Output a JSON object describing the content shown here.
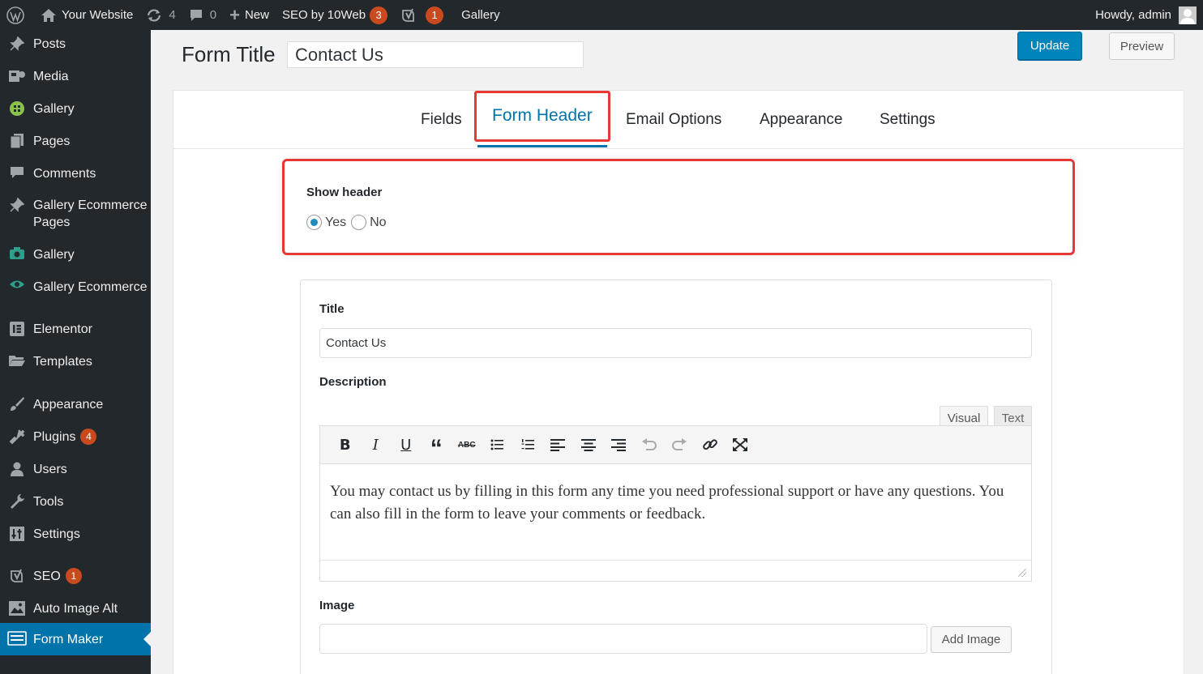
{
  "admin_bar": {
    "site_name": "Your Website",
    "updates_count": "4",
    "comments_count": "0",
    "new_label": "New",
    "seo_10web_label": "SEO by 10Web",
    "seo_10web_badge": "3",
    "yoast_badge": "1",
    "gallery_label": "Gallery",
    "howdy": "Howdy, admin"
  },
  "sidebar": {
    "items": [
      {
        "label": "Posts",
        "icon": "pushpin-icon"
      },
      {
        "label": "Media",
        "icon": "media-icon"
      },
      {
        "label": "Gallery",
        "icon": "gallery-icon"
      },
      {
        "label": "Pages",
        "icon": "pages-icon"
      },
      {
        "label": "Comments",
        "icon": "comments-icon"
      },
      {
        "label": "Gallery Ecommerce Pages",
        "icon": "pushpin-icon"
      },
      {
        "label": "Gallery",
        "icon": "camera-icon"
      },
      {
        "label": "Gallery Ecommerce",
        "icon": "eye-icon"
      },
      {
        "label": "Elementor",
        "icon": "elementor-icon"
      },
      {
        "label": "Templates",
        "icon": "folder-icon"
      },
      {
        "label": "Appearance",
        "icon": "brush-icon"
      },
      {
        "label": "Plugins",
        "icon": "plugin-icon",
        "badge": "4"
      },
      {
        "label": "Users",
        "icon": "user-icon"
      },
      {
        "label": "Tools",
        "icon": "wrench-icon"
      },
      {
        "label": "Settings",
        "icon": "settings-icon"
      },
      {
        "label": "SEO",
        "icon": "yoast-icon",
        "badge": "1"
      },
      {
        "label": "Auto Image Alt",
        "icon": "image-icon"
      },
      {
        "label": "Form Maker",
        "icon": "form-icon",
        "active": true
      }
    ]
  },
  "header": {
    "form_title_label": "Form Title",
    "form_title_value": "Contact Us",
    "update_label": "Update",
    "preview_label": "Preview"
  },
  "tabs": {
    "fields": "Fields",
    "form_header": "Form Header",
    "email_options": "Email Options",
    "appearance": "Appearance",
    "settings": "Settings"
  },
  "show_header": {
    "label": "Show header",
    "yes": "Yes",
    "no": "No",
    "selected": "Yes"
  },
  "header_fields": {
    "title_label": "Title",
    "title_value": "Contact Us",
    "description_label": "Description",
    "editor_tab_visual": "Visual",
    "editor_tab_text": "Text",
    "description_text": "You may contact us by filling in this form any time you need professional support or have any questions. You can also fill in the form to leave your comments or feedback.",
    "image_label": "Image",
    "add_image_label": "Add Image"
  },
  "colors": {
    "accent": "#0073aa",
    "highlight": "#e53935",
    "admin_dark": "#23282d",
    "badge": "#ca4a1f"
  }
}
